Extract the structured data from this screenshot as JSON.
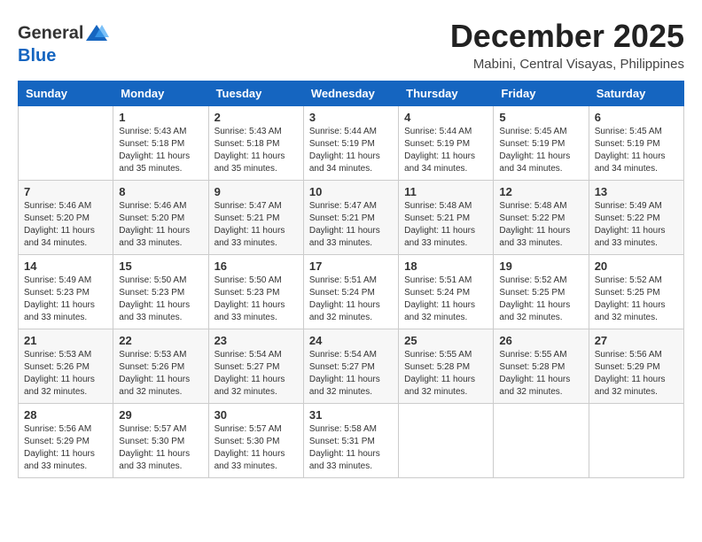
{
  "logo": {
    "general": "General",
    "blue": "Blue"
  },
  "header": {
    "month": "December 2025",
    "location": "Mabini, Central Visayas, Philippines"
  },
  "weekdays": [
    "Sunday",
    "Monday",
    "Tuesday",
    "Wednesday",
    "Thursday",
    "Friday",
    "Saturday"
  ],
  "weeks": [
    [
      {
        "day": "",
        "info": ""
      },
      {
        "day": "1",
        "info": "Sunrise: 5:43 AM\nSunset: 5:18 PM\nDaylight: 11 hours\nand 35 minutes."
      },
      {
        "day": "2",
        "info": "Sunrise: 5:43 AM\nSunset: 5:18 PM\nDaylight: 11 hours\nand 35 minutes."
      },
      {
        "day": "3",
        "info": "Sunrise: 5:44 AM\nSunset: 5:19 PM\nDaylight: 11 hours\nand 34 minutes."
      },
      {
        "day": "4",
        "info": "Sunrise: 5:44 AM\nSunset: 5:19 PM\nDaylight: 11 hours\nand 34 minutes."
      },
      {
        "day": "5",
        "info": "Sunrise: 5:45 AM\nSunset: 5:19 PM\nDaylight: 11 hours\nand 34 minutes."
      },
      {
        "day": "6",
        "info": "Sunrise: 5:45 AM\nSunset: 5:19 PM\nDaylight: 11 hours\nand 34 minutes."
      }
    ],
    [
      {
        "day": "7",
        "info": "Sunrise: 5:46 AM\nSunset: 5:20 PM\nDaylight: 11 hours\nand 34 minutes."
      },
      {
        "day": "8",
        "info": "Sunrise: 5:46 AM\nSunset: 5:20 PM\nDaylight: 11 hours\nand 33 minutes."
      },
      {
        "day": "9",
        "info": "Sunrise: 5:47 AM\nSunset: 5:21 PM\nDaylight: 11 hours\nand 33 minutes."
      },
      {
        "day": "10",
        "info": "Sunrise: 5:47 AM\nSunset: 5:21 PM\nDaylight: 11 hours\nand 33 minutes."
      },
      {
        "day": "11",
        "info": "Sunrise: 5:48 AM\nSunset: 5:21 PM\nDaylight: 11 hours\nand 33 minutes."
      },
      {
        "day": "12",
        "info": "Sunrise: 5:48 AM\nSunset: 5:22 PM\nDaylight: 11 hours\nand 33 minutes."
      },
      {
        "day": "13",
        "info": "Sunrise: 5:49 AM\nSunset: 5:22 PM\nDaylight: 11 hours\nand 33 minutes."
      }
    ],
    [
      {
        "day": "14",
        "info": "Sunrise: 5:49 AM\nSunset: 5:23 PM\nDaylight: 11 hours\nand 33 minutes."
      },
      {
        "day": "15",
        "info": "Sunrise: 5:50 AM\nSunset: 5:23 PM\nDaylight: 11 hours\nand 33 minutes."
      },
      {
        "day": "16",
        "info": "Sunrise: 5:50 AM\nSunset: 5:23 PM\nDaylight: 11 hours\nand 33 minutes."
      },
      {
        "day": "17",
        "info": "Sunrise: 5:51 AM\nSunset: 5:24 PM\nDaylight: 11 hours\nand 32 minutes."
      },
      {
        "day": "18",
        "info": "Sunrise: 5:51 AM\nSunset: 5:24 PM\nDaylight: 11 hours\nand 32 minutes."
      },
      {
        "day": "19",
        "info": "Sunrise: 5:52 AM\nSunset: 5:25 PM\nDaylight: 11 hours\nand 32 minutes."
      },
      {
        "day": "20",
        "info": "Sunrise: 5:52 AM\nSunset: 5:25 PM\nDaylight: 11 hours\nand 32 minutes."
      }
    ],
    [
      {
        "day": "21",
        "info": "Sunrise: 5:53 AM\nSunset: 5:26 PM\nDaylight: 11 hours\nand 32 minutes."
      },
      {
        "day": "22",
        "info": "Sunrise: 5:53 AM\nSunset: 5:26 PM\nDaylight: 11 hours\nand 32 minutes."
      },
      {
        "day": "23",
        "info": "Sunrise: 5:54 AM\nSunset: 5:27 PM\nDaylight: 11 hours\nand 32 minutes."
      },
      {
        "day": "24",
        "info": "Sunrise: 5:54 AM\nSunset: 5:27 PM\nDaylight: 11 hours\nand 32 minutes."
      },
      {
        "day": "25",
        "info": "Sunrise: 5:55 AM\nSunset: 5:28 PM\nDaylight: 11 hours\nand 32 minutes."
      },
      {
        "day": "26",
        "info": "Sunrise: 5:55 AM\nSunset: 5:28 PM\nDaylight: 11 hours\nand 32 minutes."
      },
      {
        "day": "27",
        "info": "Sunrise: 5:56 AM\nSunset: 5:29 PM\nDaylight: 11 hours\nand 32 minutes."
      }
    ],
    [
      {
        "day": "28",
        "info": "Sunrise: 5:56 AM\nSunset: 5:29 PM\nDaylight: 11 hours\nand 33 minutes."
      },
      {
        "day": "29",
        "info": "Sunrise: 5:57 AM\nSunset: 5:30 PM\nDaylight: 11 hours\nand 33 minutes."
      },
      {
        "day": "30",
        "info": "Sunrise: 5:57 AM\nSunset: 5:30 PM\nDaylight: 11 hours\nand 33 minutes."
      },
      {
        "day": "31",
        "info": "Sunrise: 5:58 AM\nSunset: 5:31 PM\nDaylight: 11 hours\nand 33 minutes."
      },
      {
        "day": "",
        "info": ""
      },
      {
        "day": "",
        "info": ""
      },
      {
        "day": "",
        "info": ""
      }
    ]
  ]
}
